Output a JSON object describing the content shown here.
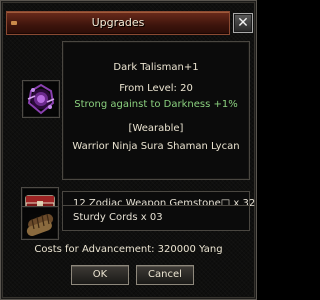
{
  "window": {
    "title": "Upgrades",
    "close_glyph": "✕"
  },
  "item": {
    "icon": "dark-talisman-icon",
    "name": "Dark Talisman+1",
    "level": "From Level: 20",
    "bonus": "Strong against to Darkness +1%",
    "wearable": "[Wearable]",
    "classes": "Warrior Ninja Sura Shaman Lycan"
  },
  "materials": [
    {
      "icon": "zodiac-gemstone-chest-icon",
      "text": "12 Zodiac Weapon Gemstone□ x 32"
    },
    {
      "icon": "sturdy-cords-icon",
      "text": "Sturdy Cords x 03"
    }
  ],
  "cost": "Costs for Advancement: 320000 Yang",
  "buttons": {
    "ok": "OK",
    "cancel": "Cancel"
  },
  "colors": {
    "title_bar": "#5a2214",
    "bonus_text": "#8bd17f",
    "text": "#ece5d2"
  }
}
